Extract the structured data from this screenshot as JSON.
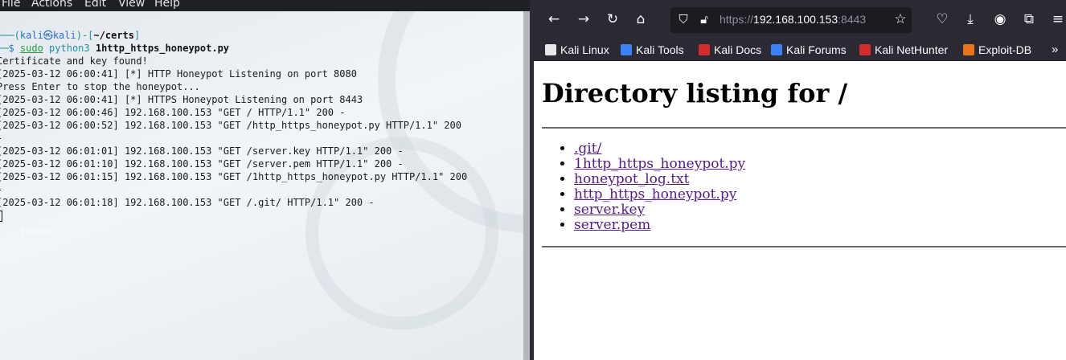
{
  "terminal": {
    "menu": [
      "File",
      "Actions",
      "Edit",
      "View",
      "Help"
    ],
    "prompt": {
      "prefix": "┌──(",
      "user": "kali",
      "at": "㉿",
      "host": "kali",
      "mid": ")-[",
      "path": "~/certs",
      "end": "]",
      "second": "└─",
      "dollar": "$ ",
      "cmd_sudo": "sudo",
      "cmd_python": "python3",
      "cmd_file": "1http_https_honeypot.py"
    },
    "output": [
      "Certificate and key found!",
      "[2025-03-12 06:00:41] [*] HTTP Honeypot Listening on port 8080",
      "Press Enter to stop the honeypot...",
      "[2025-03-12 06:00:41] [*] HTTPS Honeypot Listening on port 8443",
      "[2025-03-12 06:00:46] 192.168.100.153 \"GET / HTTP/1.1\" 200 -",
      "[2025-03-12 06:00:52] 192.168.100.153 \"GET /http_https_honeypot.py HTTP/1.1\" 200",
      "-",
      "[2025-03-12 06:01:01] 192.168.100.153 \"GET /server.key HTTP/1.1\" 200 -",
      "[2025-03-12 06:01:10] 192.168.100.153 \"GET /server.pem HTTP/1.1\" 200 -",
      "[2025-03-12 06:01:15] 192.168.100.153 \"GET /1http_https_honeypot.py HTTP/1.1\" 200",
      "-",
      "[2025-03-12 06:01:18] 192.168.100.153 \"GET /.git/ HTTP/1.1\" 200 -"
    ],
    "wallpaper_text": "Home"
  },
  "browser": {
    "url_scheme": "https://",
    "url_host": "192.168.100.153",
    "url_port": ":8443",
    "bookmarks": [
      {
        "label": "Kali Linux",
        "icon": "kali-dragon-icon",
        "color": "#e8e8e8"
      },
      {
        "label": "Kali Tools",
        "icon": "kali-tools-icon",
        "color": "#3b82f6"
      },
      {
        "label": "Kali Docs",
        "icon": "kali-docs-icon",
        "color": "#d42b2b"
      },
      {
        "label": "Kali Forums",
        "icon": "kali-forums-icon",
        "color": "#3b82f6"
      },
      {
        "label": "Kali NetHunter",
        "icon": "kali-nethunter-icon",
        "color": "#d42b2b"
      },
      {
        "label": "Exploit-DB",
        "icon": "exploit-db-icon",
        "color": "#e8751a"
      }
    ],
    "page": {
      "heading": "Directory listing for /",
      "files": [
        ".git/",
        "1http_https_honeypot.py",
        "honeypot_log.txt",
        "http_https_honeypot.py",
        "server.key",
        "server.pem"
      ]
    }
  }
}
